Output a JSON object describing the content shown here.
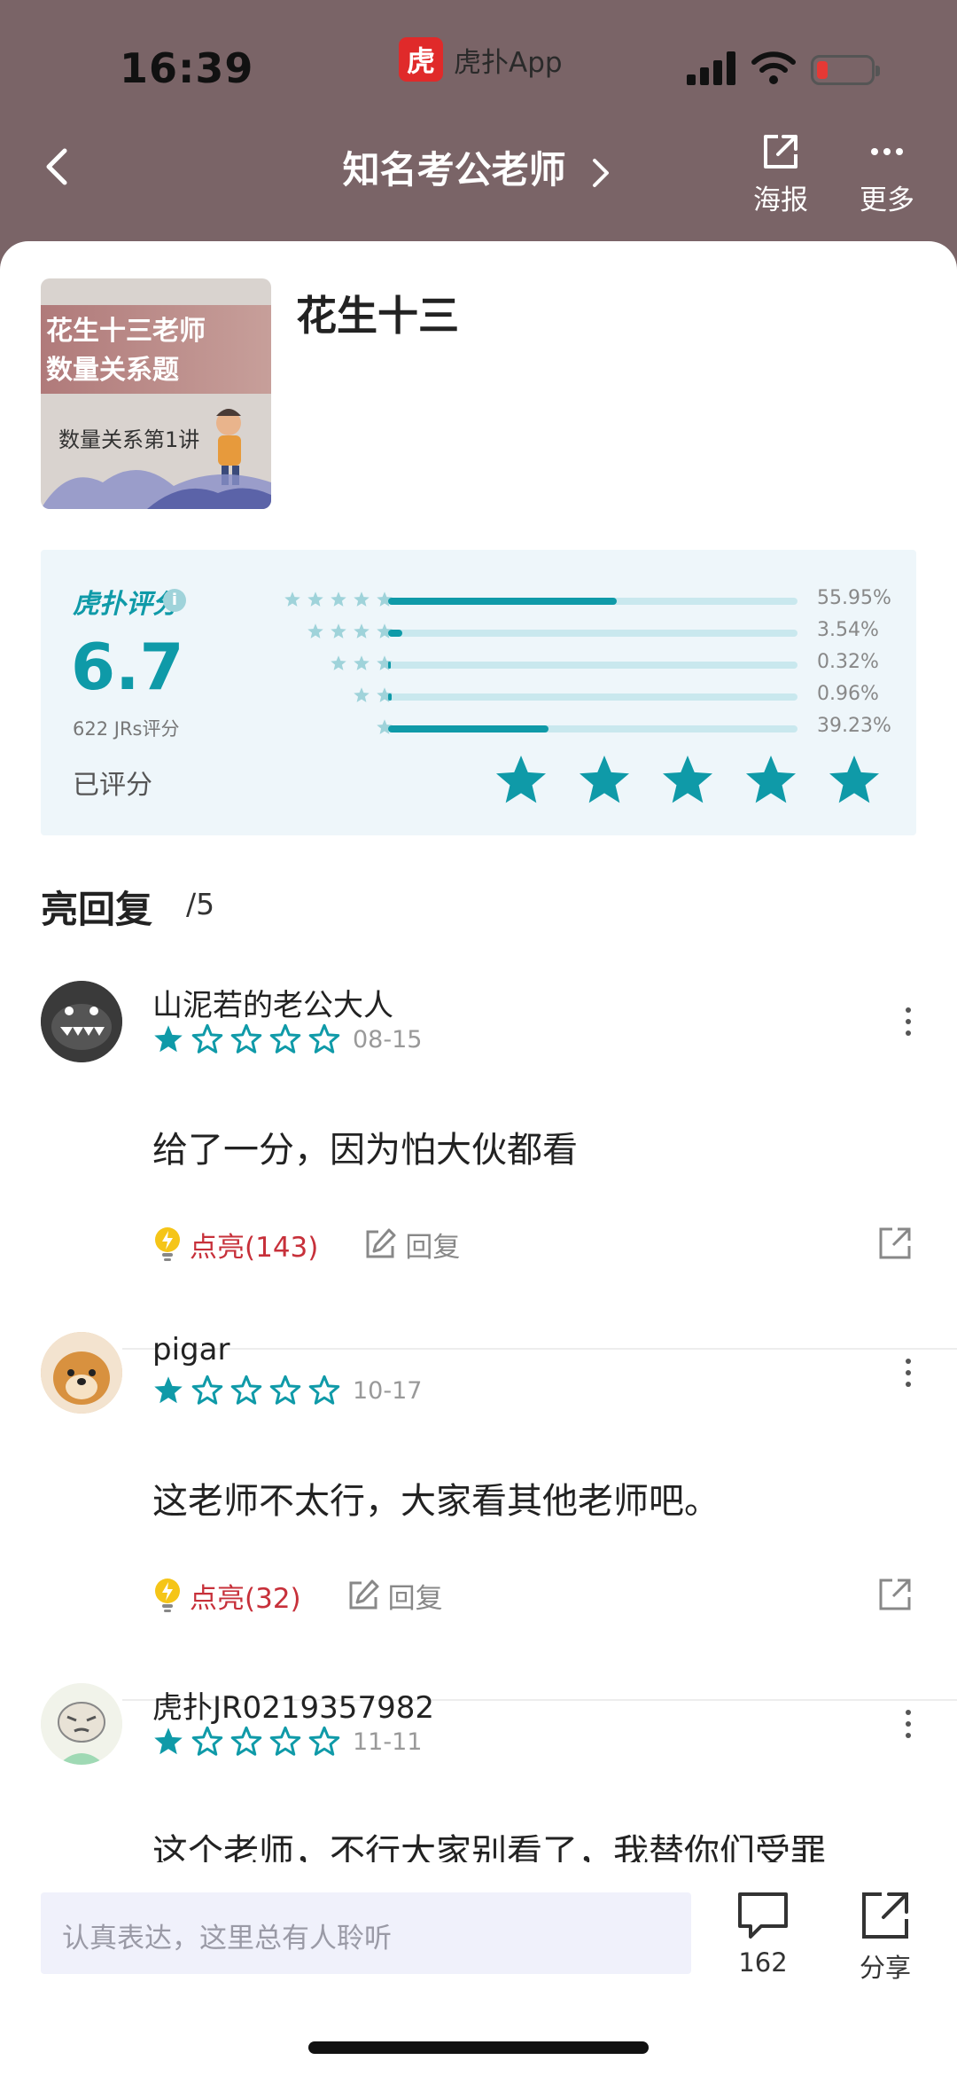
{
  "status_bar": {
    "time": "16:39",
    "app_badge": "虎扑App",
    "app_icon_glyph": "虎",
    "battery": "low",
    "signal": "4 bars",
    "wifi": "on"
  },
  "nav": {
    "title": "知名考公老师",
    "poster_label": "海报",
    "more_label": "更多"
  },
  "item": {
    "name": "花生十三",
    "cover": {
      "line1": "花生十三老师",
      "line2": "数量关系题",
      "line3": "数量关系第1讲"
    }
  },
  "rating": {
    "brand": "虎扑评分",
    "score": "6.7",
    "count_text": "622 JRs评分",
    "rated_text": "已评分",
    "my_stars": 5,
    "distribution": [
      {
        "stars": 5,
        "percent": 55.95,
        "label": "55.95%"
      },
      {
        "stars": 4,
        "percent": 3.54,
        "label": "3.54%"
      },
      {
        "stars": 3,
        "percent": 0.32,
        "label": "0.32%"
      },
      {
        "stars": 2,
        "percent": 0.96,
        "label": "0.96%"
      },
      {
        "stars": 1,
        "percent": 39.23,
        "label": "39.23%"
      }
    ]
  },
  "section": {
    "title": "亮回复",
    "count": "/5"
  },
  "comments": [
    {
      "user": "山泥若的老公大人",
      "stars": 1,
      "date": "08-15",
      "text": "给了一分，因为怕大伙都看",
      "light_label": "点亮(143)",
      "reply_label": "回复"
    },
    {
      "user": "pigar",
      "stars": 1,
      "date": "10-17",
      "text": "这老师不太行，大家看其他老师吧。",
      "light_label": "点亮(32)",
      "reply_label": "回复"
    },
    {
      "user": "虎扑JR0219357982",
      "stars": 1,
      "date": "11-11",
      "text": "这个老师，不行大家别看了，我替你们受罪"
    }
  ],
  "bottom_bar": {
    "input_placeholder": "认真表达，这里总有人聆听",
    "comments_count": "162",
    "share_label": "分享"
  },
  "colors": {
    "accent": "#0f9aa8",
    "header_bg": "#7a6467",
    "light_red": "#c7303a"
  }
}
